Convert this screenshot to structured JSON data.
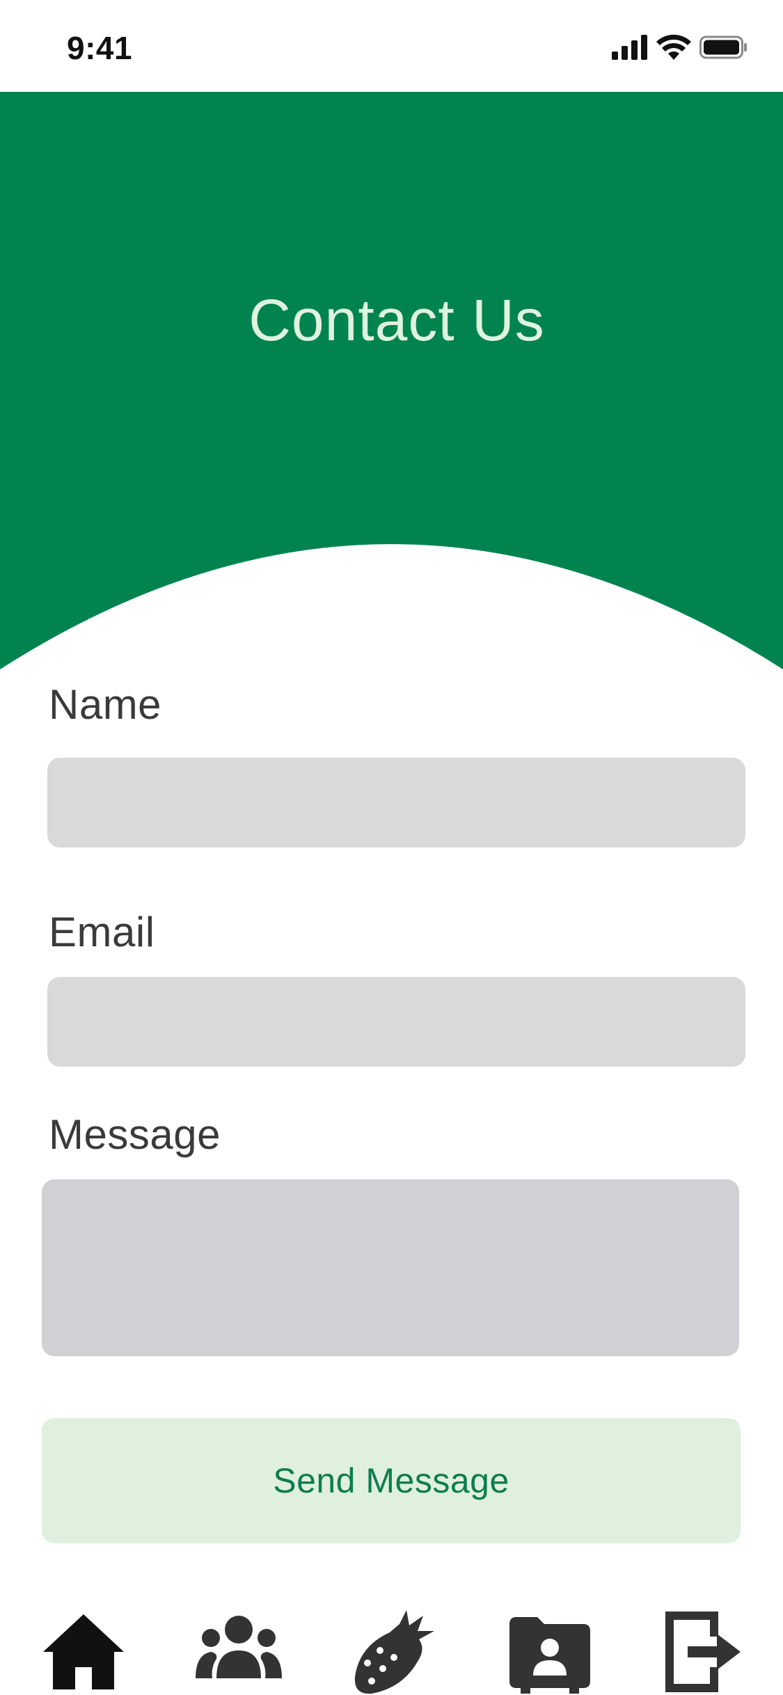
{
  "status_bar": {
    "time": "9:41",
    "icons": [
      "signal-icon",
      "wifi-icon",
      "battery-icon"
    ]
  },
  "header": {
    "title": "Contact Us",
    "background_color": "#00834f",
    "title_color": "#dff3df"
  },
  "form": {
    "name_label": "Name",
    "name_value": "",
    "email_label": "Email",
    "email_value": "",
    "message_label": "Message",
    "message_value": "",
    "submit_label": "Send Message"
  },
  "bottom_nav": {
    "items": [
      {
        "icon": "home-icon"
      },
      {
        "icon": "group-icon"
      },
      {
        "icon": "strawberry-icon"
      },
      {
        "icon": "contact-folder-icon"
      },
      {
        "icon": "logout-icon"
      }
    ]
  },
  "colors": {
    "accent": "#00834f",
    "button_bg": "#dff0de",
    "field_bg": "#d9d9d9",
    "nav_icon": "#333333"
  }
}
